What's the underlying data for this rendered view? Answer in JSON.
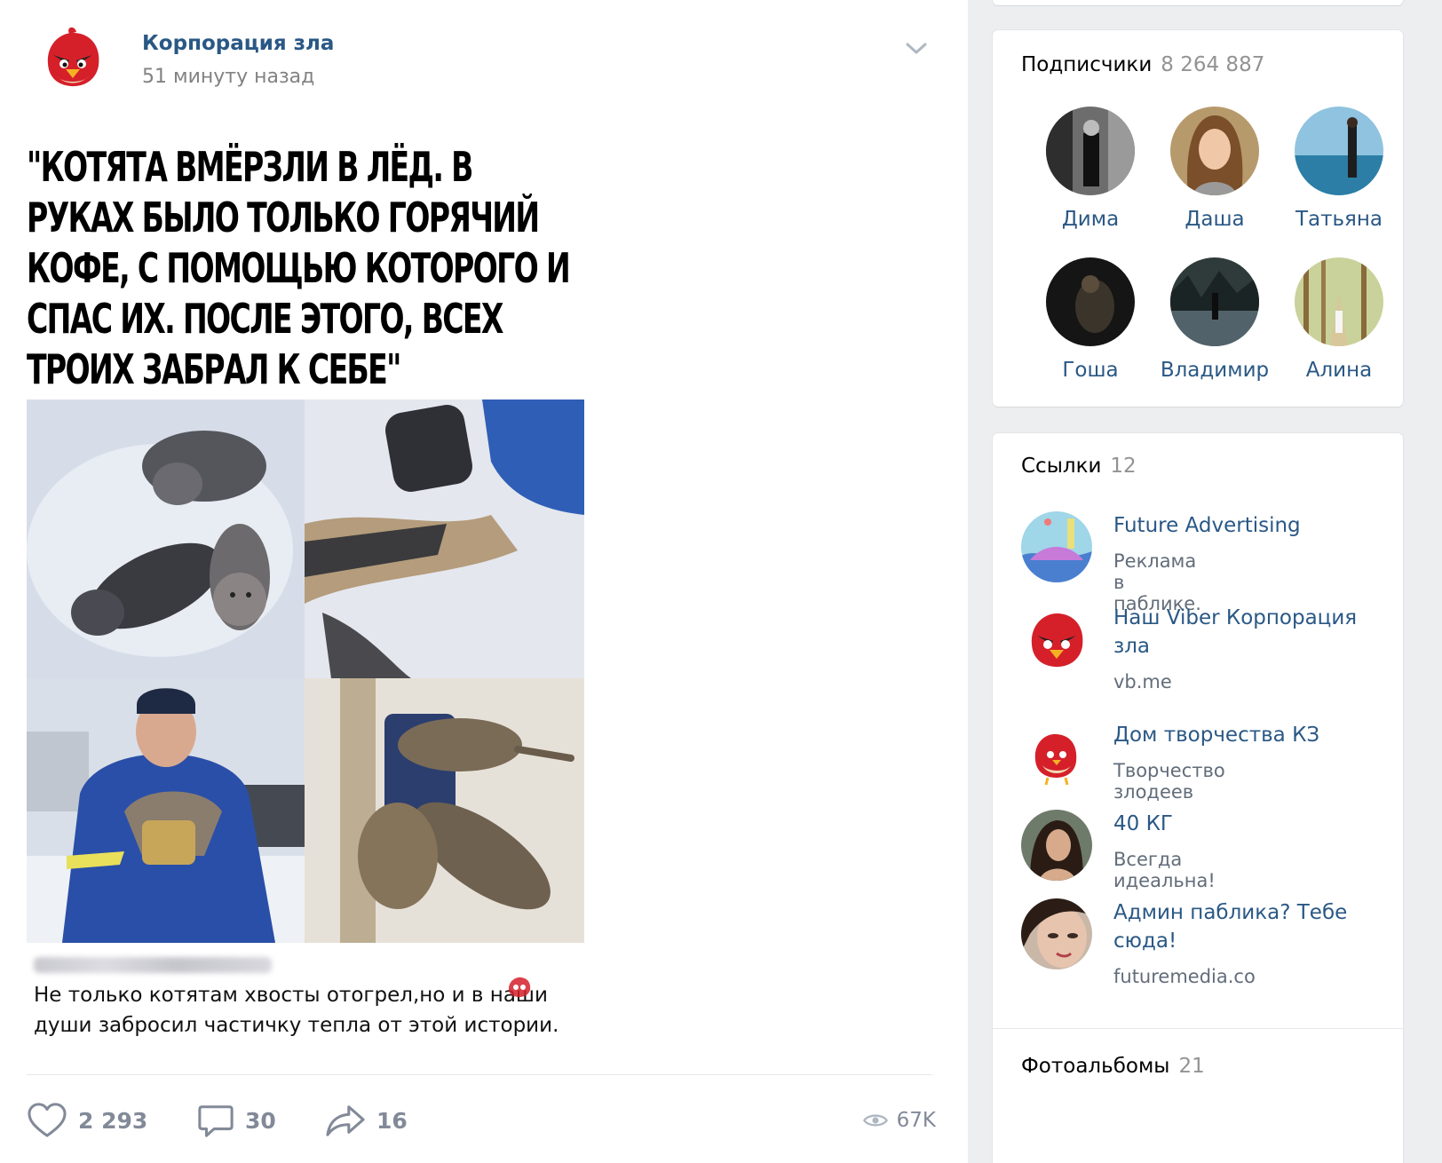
{
  "post": {
    "author": "Корпорация зла",
    "time": "51 минуту назад",
    "meme_title": "\"КОТЯТА ВМЁРЗЛИ В ЛЁД. В РУКАХ БЫЛО ТОЛЬКО ГОРЯЧИЙ КОФЕ, С ПОМОЩЬЮ КОТОРОГО И СПАС ИХ. ПОСЛЕ ЭТОГО, ВСЕХ ТРОИХ ЗАБРАЛ К СЕБЕ\"",
    "comment_line1": "Не только котятам хвосты отогрел,но и в наши",
    "comment_line2": "души забросил частичку тепла от этой истории.",
    "likes": "2 293",
    "comments": "30",
    "shares": "16",
    "views": "67K"
  },
  "sidebar": {
    "subscribers": {
      "title": "Подписчики",
      "count": "8 264 887",
      "members": [
        {
          "name": "Дима"
        },
        {
          "name": "Даша"
        },
        {
          "name": "Татьяна"
        },
        {
          "name": "Гоша"
        },
        {
          "name": "Владимир"
        },
        {
          "name": "Алина"
        }
      ]
    },
    "links": {
      "title": "Ссылки",
      "count": "12",
      "items": [
        {
          "name": "Future Advertising",
          "desc": "Реклама в паблике."
        },
        {
          "name": "Наш Viber Корпорация зла",
          "desc": "vb.me"
        },
        {
          "name": "Дом творчества КЗ",
          "desc": "Творчество злодеев"
        },
        {
          "name": "40 КГ",
          "desc": "Всегда идеальна!"
        },
        {
          "name": "Админ паблика? Тебе сюда!",
          "desc": "futuremedia.co"
        }
      ]
    },
    "albums": {
      "title": "Фотоальбомы",
      "count": "21"
    }
  },
  "colors": {
    "link": "#2a5885",
    "muted": "#828a99",
    "background": "#edeef0"
  }
}
